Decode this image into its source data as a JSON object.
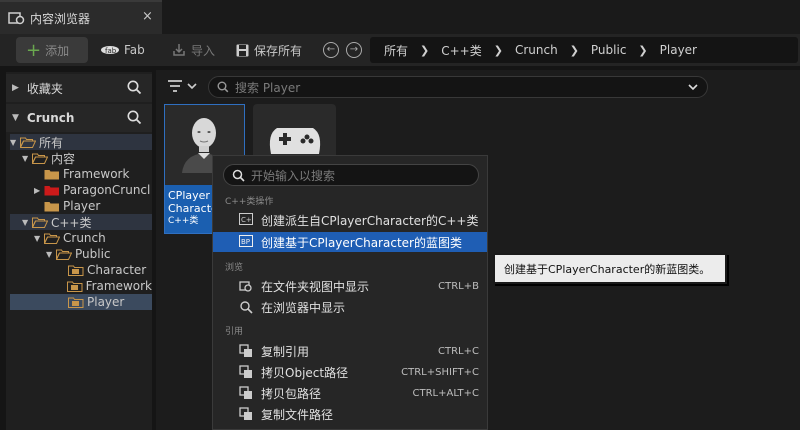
{
  "tab": {
    "title": "内容浏览器",
    "close": "×"
  },
  "toolbar": {
    "add": "添加",
    "fab": "Fab",
    "import": "导入",
    "save_all": "保存所有",
    "nav_back": "←",
    "nav_forward": "→"
  },
  "breadcrumb": [
    "所有",
    "C++类",
    "Crunch",
    "Public",
    "Player"
  ],
  "left_panel": {
    "favorites": "收藏夹",
    "project": "Crunch",
    "tree": [
      {
        "label": "所有",
        "indent": 0,
        "expanded": true,
        "style": "hl",
        "folder": "open"
      },
      {
        "label": "内容",
        "indent": 1,
        "expanded": true,
        "style": "",
        "folder": "open"
      },
      {
        "label": "Framework",
        "indent": 2,
        "expanded": null,
        "style": "",
        "folder": "closed"
      },
      {
        "label": "ParagonCruncl",
        "indent": 2,
        "expanded": false,
        "style": "",
        "folder": "red"
      },
      {
        "label": "Player",
        "indent": 2,
        "expanded": null,
        "style": "",
        "folder": "closed"
      },
      {
        "label": "C++类",
        "indent": 1,
        "expanded": true,
        "style": "hl",
        "folder": "open"
      },
      {
        "label": "Crunch",
        "indent": 2,
        "expanded": true,
        "style": "",
        "folder": "open"
      },
      {
        "label": "Public",
        "indent": 3,
        "expanded": true,
        "style": "",
        "folder": "open"
      },
      {
        "label": "Character",
        "indent": 4,
        "expanded": null,
        "style": "",
        "folder": "cls"
      },
      {
        "label": "Framework",
        "indent": 4,
        "expanded": null,
        "style": "",
        "folder": "cls"
      },
      {
        "label": "Player",
        "indent": 4,
        "expanded": null,
        "style": "sel",
        "folder": "cls"
      }
    ]
  },
  "search": {
    "placeholder": "搜索 Player"
  },
  "assets": [
    {
      "name_line1": "CPlayer",
      "name_line2": "Characte",
      "type": "C++类"
    }
  ],
  "context_menu": {
    "search_placeholder": "开始输入以搜索",
    "sections": {
      "cpp": "C++类操作",
      "browse": "浏览",
      "reference": "引用"
    },
    "items": {
      "create_derived": "创建派生自CPlayerCharacter的C++类",
      "create_blueprint": "创建基于CPlayerCharacter的蓝图类",
      "show_in_folder": "在文件夹视图中显示",
      "show_in_folder_sc": "CTRL+B",
      "show_in_browser": "在浏览器中显示",
      "copy_reference": "复制引用",
      "copy_reference_sc": "CTRL+C",
      "copy_object_path": "拷贝Object路径",
      "copy_object_path_sc": "CTRL+SHIFT+C",
      "copy_package_path": "拷贝包路径",
      "copy_package_path_sc": "CTRL+ALT+C",
      "copy_file_path": "复制文件路径"
    }
  },
  "tooltip": "创建基于CPlayerCharacter的新蓝图类。",
  "colors": {
    "accent": "#1f5eb4",
    "folder": "#c8964a",
    "folder_red": "#cc1a1a",
    "selection": "#3b4a5e"
  }
}
